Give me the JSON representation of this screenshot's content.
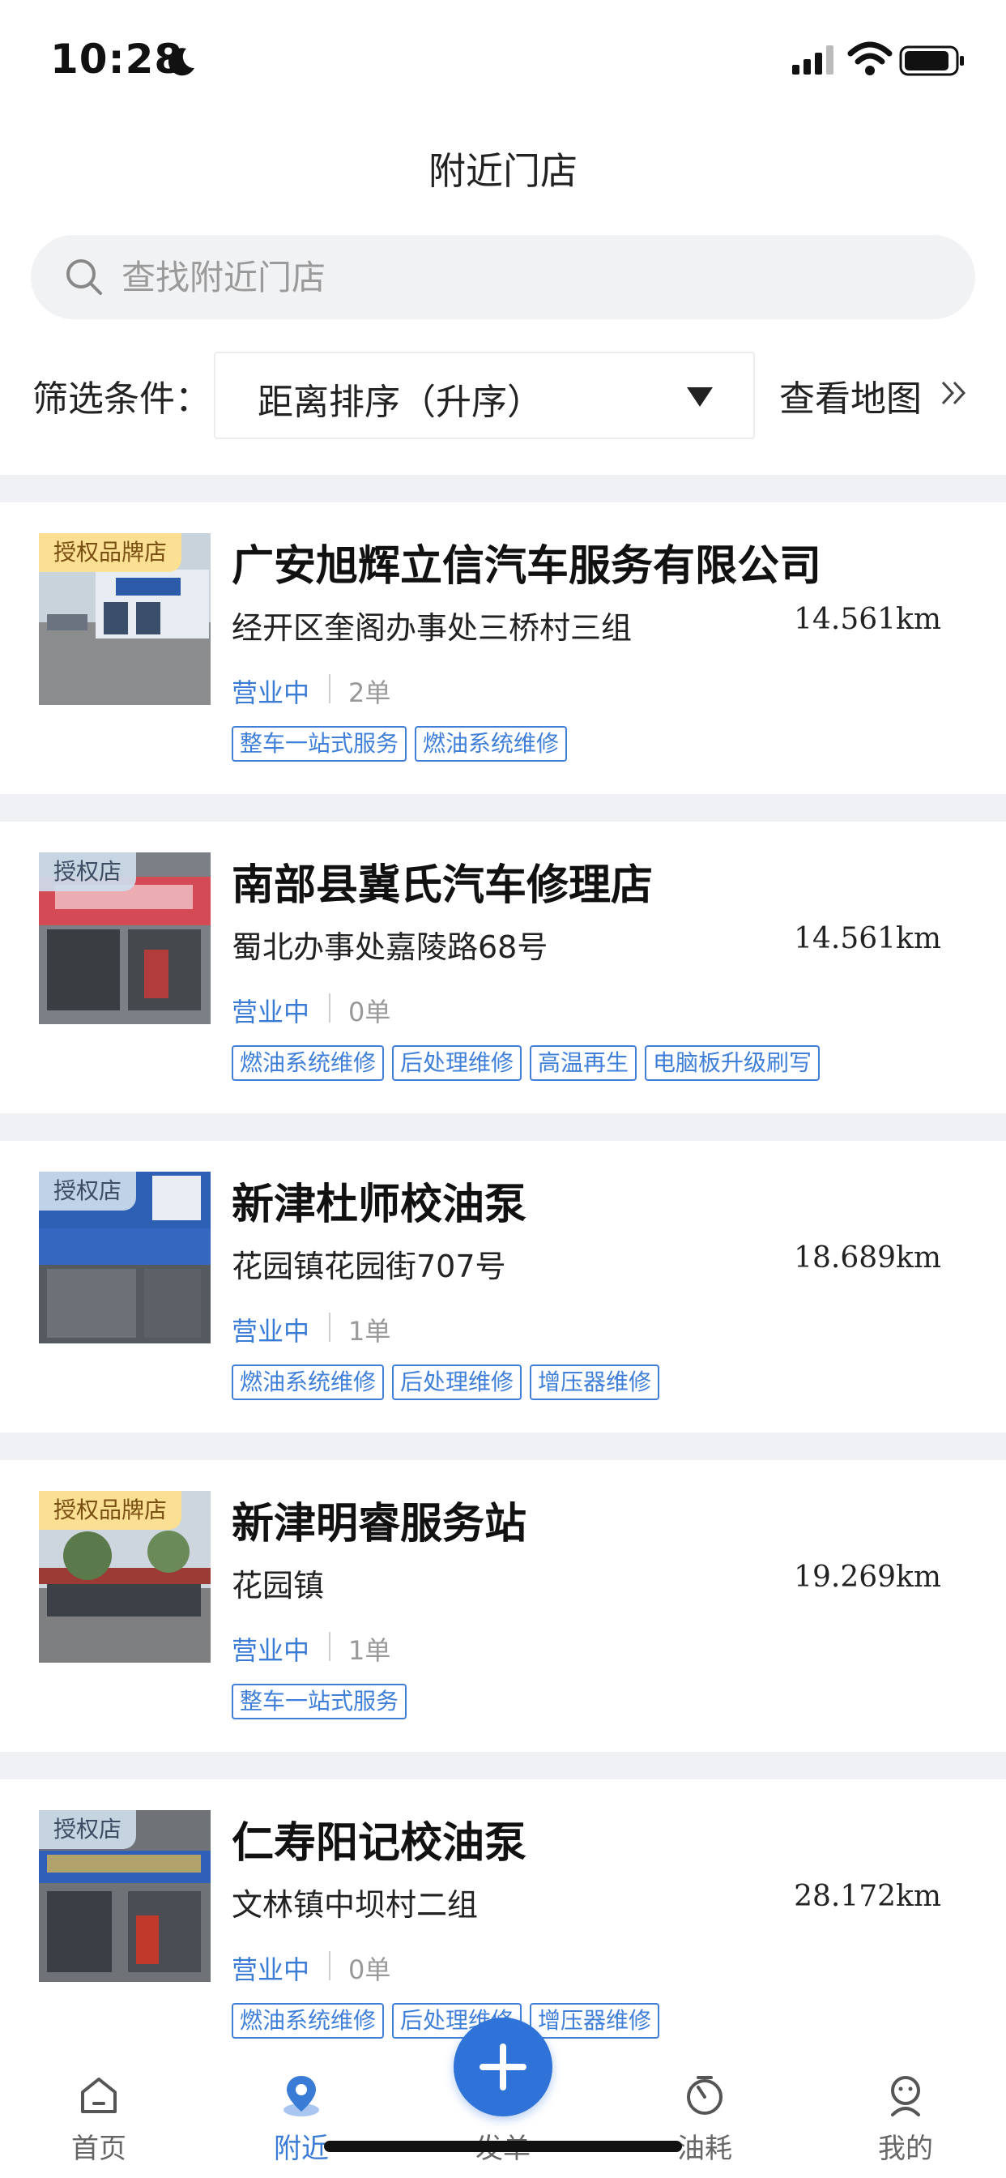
{
  "status_bar": {
    "time": "10:28"
  },
  "page": {
    "title": "附近门店"
  },
  "search": {
    "placeholder": "查找附近门店",
    "value": ""
  },
  "filter": {
    "label": "筛选条件：",
    "selected": "距离排序（升序）",
    "map_link": "查看地图"
  },
  "stores": [
    {
      "badge": "授权品牌店",
      "badge_type": "brand",
      "name": "广安旭辉立信汽车服务有限公司",
      "address": "经开区奎阁办事处三桥村三组",
      "distance": "14.561km",
      "status": "营业中",
      "orders": "2单",
      "tags": [
        "整车一站式服务",
        "燃油系统维修"
      ]
    },
    {
      "badge": "授权店",
      "badge_type": "plain",
      "name": "南部县冀氏汽车修理店",
      "address": "蜀北办事处嘉陵路68号",
      "distance": "14.561km",
      "status": "营业中",
      "orders": "0单",
      "tags": [
        "燃油系统维修",
        "后处理维修",
        "高温再生",
        "电脑板升级刷写"
      ]
    },
    {
      "badge": "授权店",
      "badge_type": "plain",
      "name": "新津杜师校油泵",
      "address": "花园镇花园街707号",
      "distance": "18.689km",
      "status": "营业中",
      "orders": "1单",
      "tags": [
        "燃油系统维修",
        "后处理维修",
        "增压器维修"
      ]
    },
    {
      "badge": "授权品牌店",
      "badge_type": "brand",
      "name": "新津明睿服务站",
      "address": "花园镇",
      "distance": "19.269km",
      "status": "营业中",
      "orders": "1单",
      "tags": [
        "整车一站式服务"
      ]
    },
    {
      "badge": "授权店",
      "badge_type": "plain",
      "name": "仁寿阳记校油泵",
      "address": "文林镇中坝村二组",
      "distance": "28.172km",
      "status": "营业中",
      "orders": "0单",
      "tags": [
        "燃油系统维修",
        "后处理维修",
        "增压器维修"
      ]
    }
  ],
  "tab_bar": {
    "tabs": [
      {
        "label": "首页",
        "icon": "home-icon"
      },
      {
        "label": "附近",
        "icon": "location-pin-icon",
        "active": true
      },
      {
        "label": "发单",
        "icon": "plus-icon"
      },
      {
        "label": "油耗",
        "icon": "gauge-icon"
      },
      {
        "label": "我的",
        "icon": "profile-icon"
      }
    ]
  },
  "colors": {
    "accent": "#3a7bd5",
    "fab": "#2f73d9",
    "tag": "#3f7fd8",
    "separator": "#f0f1f4"
  }
}
